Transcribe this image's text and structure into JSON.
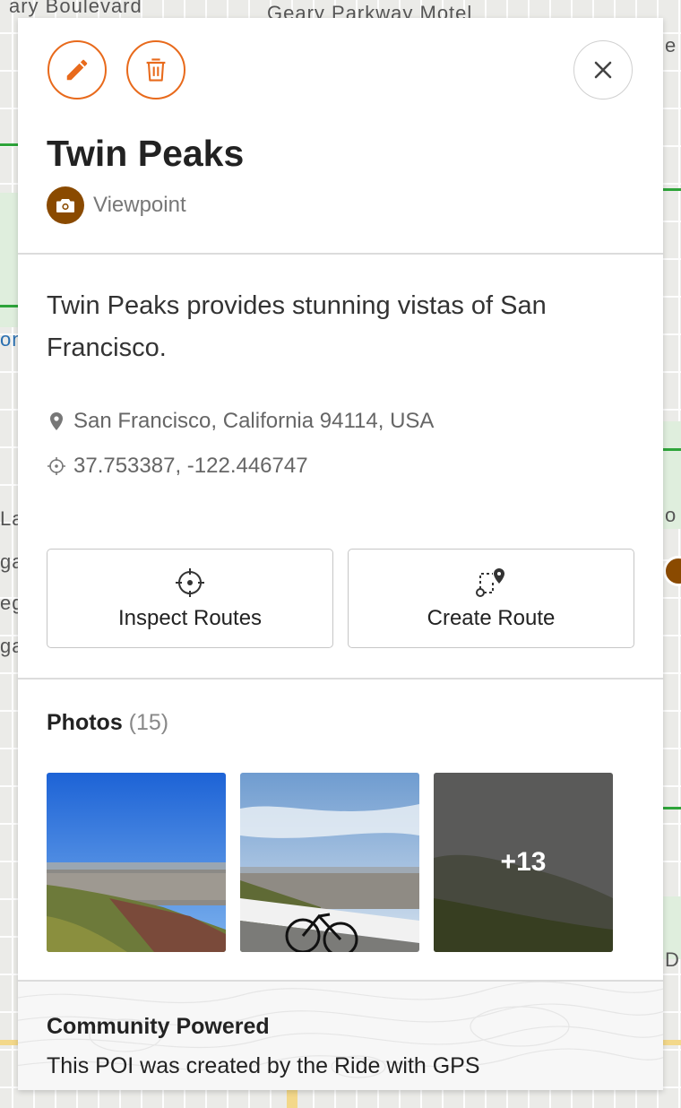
{
  "map": {
    "labels": [
      "ary Boulevard",
      "Geary Parkway Motel",
      "ona",
      "La",
      "ga",
      "eg",
      "ga",
      "e",
      "o",
      "D"
    ]
  },
  "toolbar": {
    "edit_icon": "pencil-icon",
    "delete_icon": "trash-icon",
    "close_icon": "close-icon"
  },
  "poi": {
    "title": "Twin Peaks",
    "type": "Viewpoint",
    "type_icon": "camera-icon",
    "description": "Twin Peaks provides stunning vistas of San Francisco.",
    "address": "San Francisco, California 94114, USA",
    "coordinates": "37.753387, -122.446747"
  },
  "actions": {
    "inspect_routes": "Inspect Routes",
    "create_route": "Create Route"
  },
  "photos": {
    "label": "Photos",
    "count": "(15)",
    "more": "+13"
  },
  "community": {
    "title": "Community Powered",
    "text": "This POI was created by the Ride with GPS"
  },
  "colors": {
    "accent": "#e86a1c",
    "poi_brown": "#8a4a00",
    "map_green": "#2ea43a"
  }
}
